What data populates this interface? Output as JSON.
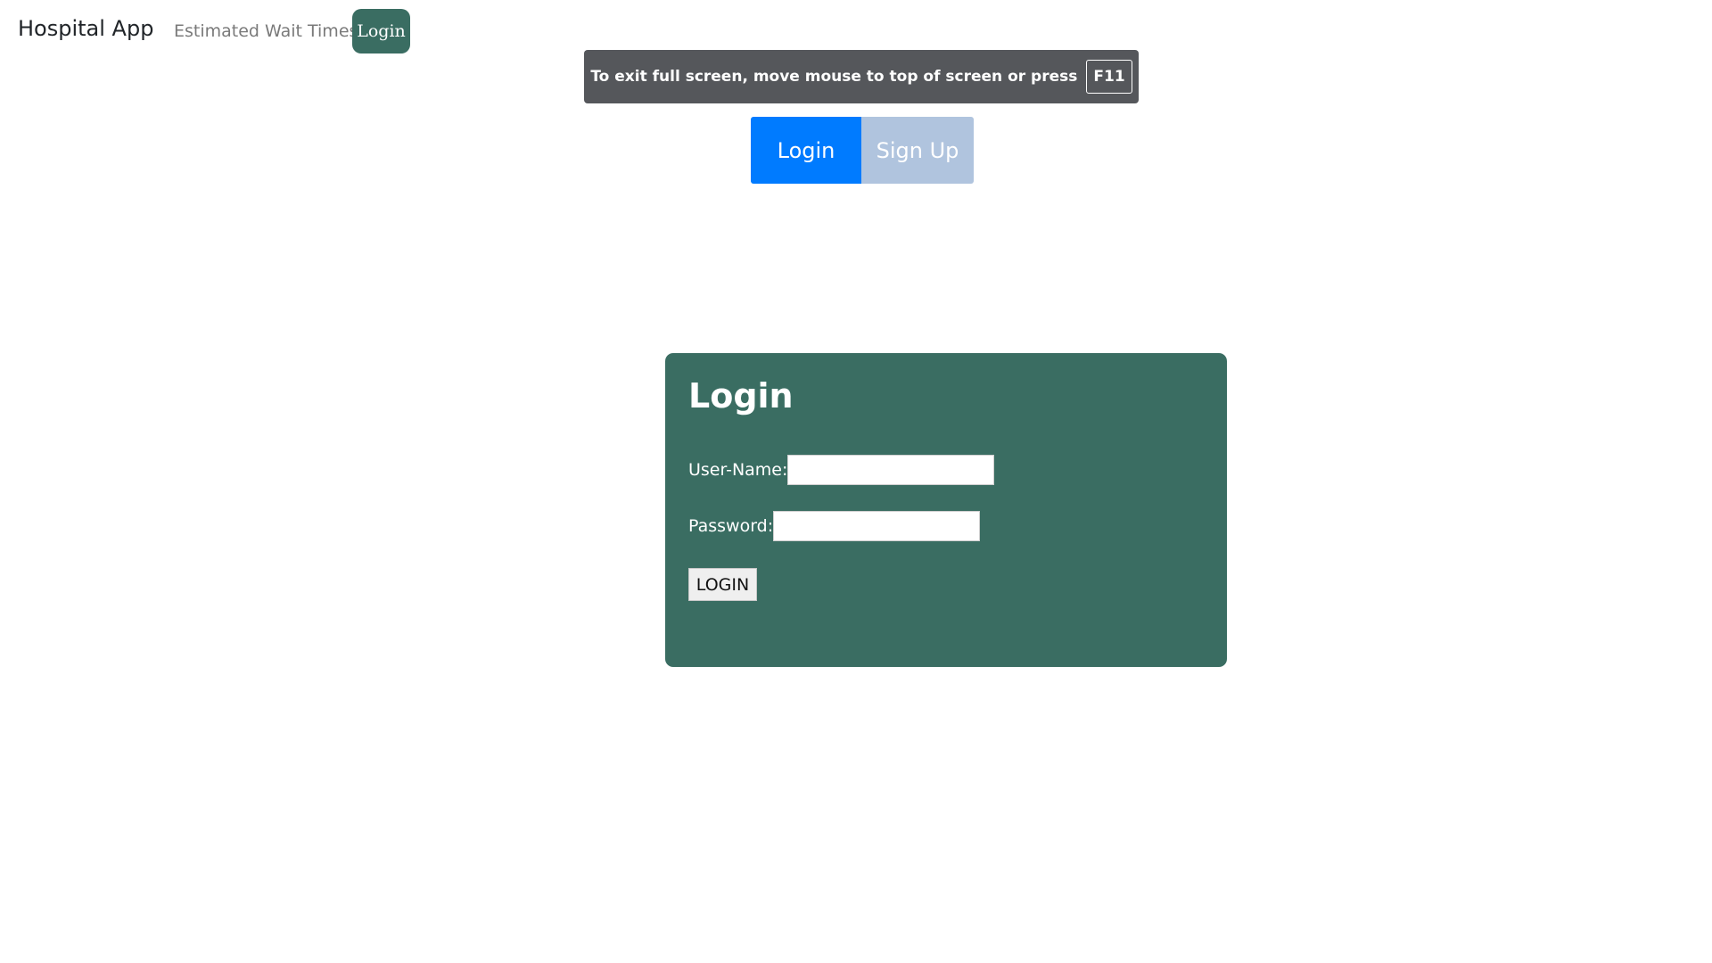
{
  "navbar": {
    "brand": "Hospital App",
    "wait_times_link": "Estimated Wait Times",
    "login_button": "Login"
  },
  "fullscreen_notice": {
    "text": "To exit full screen, move mouse to top of screen or press",
    "key": "F11"
  },
  "toggle": {
    "login_label": "Login",
    "signup_label": "Sign Up"
  },
  "login_card": {
    "title": "Login",
    "username_label": "User-Name:",
    "username_value": "",
    "password_label": "Password:",
    "password_value": "",
    "submit_label": "LOGIN"
  },
  "colors": {
    "card_background": "#3a6d62",
    "toggle_active": "#007bff",
    "toggle_inactive": "#b0c4de",
    "notice_background": "#55575b"
  }
}
